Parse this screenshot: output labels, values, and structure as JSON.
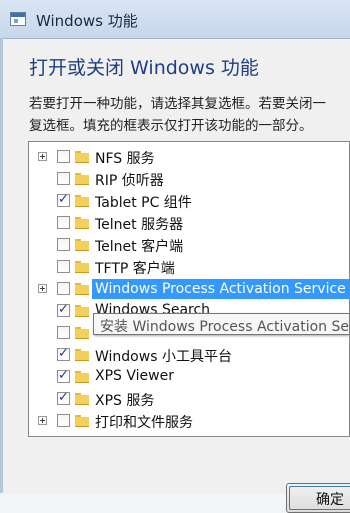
{
  "window": {
    "title": "Windows 功能"
  },
  "heading": "打开或关闭 Windows 功能",
  "description": [
    "若要打开一种功能，请选择其复选框。若要关闭一",
    "复选框。填充的框表示仅打开该功能的一部分。"
  ],
  "features": [
    {
      "label": "NFS 服务",
      "expandable": true,
      "checked": false
    },
    {
      "label": "RIP 侦听器",
      "expandable": false,
      "checked": false
    },
    {
      "label": "Tablet PC 组件",
      "expandable": false,
      "checked": true
    },
    {
      "label": "Telnet 服务器",
      "expandable": false,
      "checked": false
    },
    {
      "label": "Telnet 客户端",
      "expandable": false,
      "checked": false
    },
    {
      "label": "TFTP 客户端",
      "expandable": false,
      "checked": false
    },
    {
      "label": "Windows Process Activation Service",
      "expandable": true,
      "checked": false,
      "selected": true
    },
    {
      "label": "Windows Search",
      "expandable": false,
      "checked": true
    },
    {
      "label": "",
      "expandable": false,
      "checked": false
    },
    {
      "label": "Windows 小工具平台",
      "expandable": false,
      "checked": true
    },
    {
      "label": "XPS Viewer",
      "expandable": false,
      "checked": true
    },
    {
      "label": "XPS 服务",
      "expandable": false,
      "checked": true
    },
    {
      "label": "打印和文件服务",
      "expandable": true,
      "checked": false
    }
  ],
  "tooltip": "安装 Windows Process Activation Service",
  "buttons": {
    "ok": "确定"
  }
}
